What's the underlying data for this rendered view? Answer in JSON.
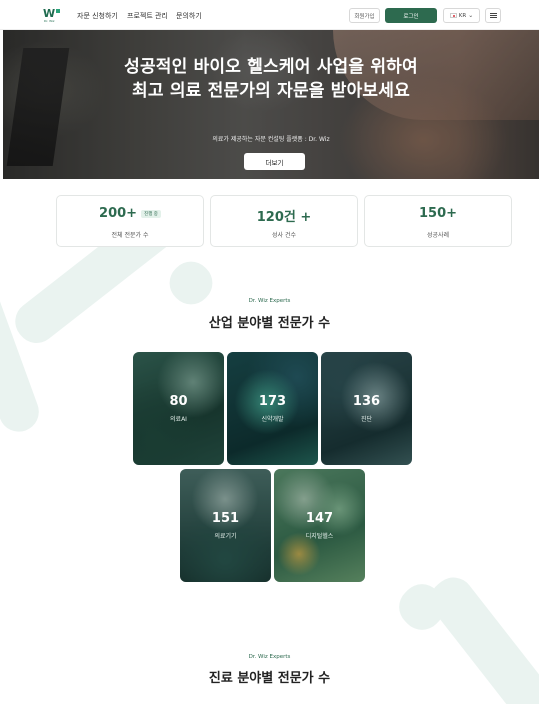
{
  "header": {
    "logo_text": "W",
    "logo_sub": "Dr. Wiz",
    "nav": [
      "자문 신청하기",
      "프로젝트 관리",
      "문의하기"
    ],
    "join_label": "회원가입",
    "login_label": "로그인",
    "lang_label": "KR"
  },
  "hero": {
    "title_line1": "성공적인 바이오 헬스케어 사업을 위하여",
    "title_line2": "최고 의료 전문가의 자문을 받아보세요",
    "subtitle": "의료가 제공하는 자문 컨설팅 플랫폼 : Dr. Wiz",
    "cta_label": "더보기",
    "slides_total": 4,
    "slide_active": 1
  },
  "stats": [
    {
      "value": "200+",
      "badge": "진행 중",
      "label": "전체 전문가 수"
    },
    {
      "value": "120건 +",
      "badge": "",
      "label": "성사 건수"
    },
    {
      "value": "150+",
      "badge": "",
      "label": "성공사례"
    }
  ],
  "industry_section": {
    "eyebrow": "Dr. Wiz Experts",
    "title": "산업 분야별 전문가 수",
    "cards": [
      {
        "count": "80",
        "label": "의료AI"
      },
      {
        "count": "173",
        "label": "신약개발"
      },
      {
        "count": "136",
        "label": "진단"
      },
      {
        "count": "151",
        "label": "의료기기"
      },
      {
        "count": "147",
        "label": "디지털헬스"
      }
    ]
  },
  "clinical_section": {
    "eyebrow": "Dr. Wiz Experts",
    "title": "진료 분야별 전문가 수"
  },
  "colors": {
    "brand": "#2d6a4f",
    "accent_light": "#eaf3f0"
  }
}
